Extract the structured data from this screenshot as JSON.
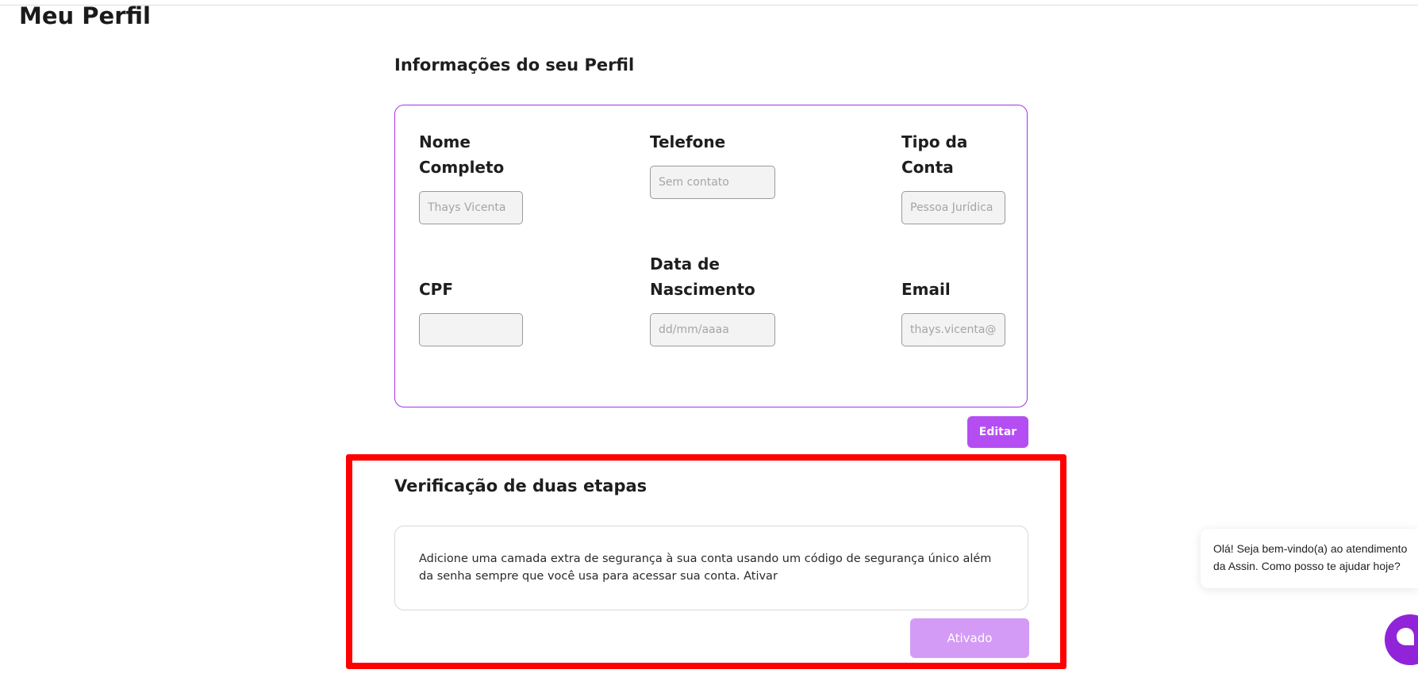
{
  "page": {
    "title": "Meu Perfil"
  },
  "profile_section": {
    "title": "Informações do seu Perfil",
    "fields": {
      "nome": {
        "label": "Nome Completo",
        "placeholder": "Thays Vicenta",
        "value": ""
      },
      "telefone": {
        "label": "Telefone",
        "placeholder": "Sem contato",
        "value": ""
      },
      "tipo_conta": {
        "label": "Tipo da Conta",
        "placeholder": "Pessoa Jurídica",
        "value": ""
      },
      "cpf": {
        "label": "CPF",
        "placeholder": "",
        "value": ""
      },
      "nascimento": {
        "label": "Data de Nascimento",
        "placeholder": "dd/mm/aaaa",
        "value": ""
      },
      "email": {
        "label": "Email",
        "placeholder": "thays.vicenta@c",
        "value": ""
      }
    },
    "edit_label": "Editar"
  },
  "two_factor_section": {
    "title": "Verificação de duas etapas",
    "description": "Adicione uma camada extra de segurança à sua conta usando um código de segurança único além da senha sempre que você usa para acessar sua conta. Ativar",
    "status_button_label": "Ativado"
  },
  "chat": {
    "greeting": "Olá! Seja bem-vindo(a) ao atendimento da Assin. Como posso te ajudar hoje?",
    "launcher_icon": "chat-bubble-icon"
  },
  "colors": {
    "accent": "#b44ef2",
    "accent_disabled": "#d39bf5",
    "card_border": "#a334e6",
    "highlight": "#ff0000",
    "chat_launcher": "#9124d8"
  }
}
